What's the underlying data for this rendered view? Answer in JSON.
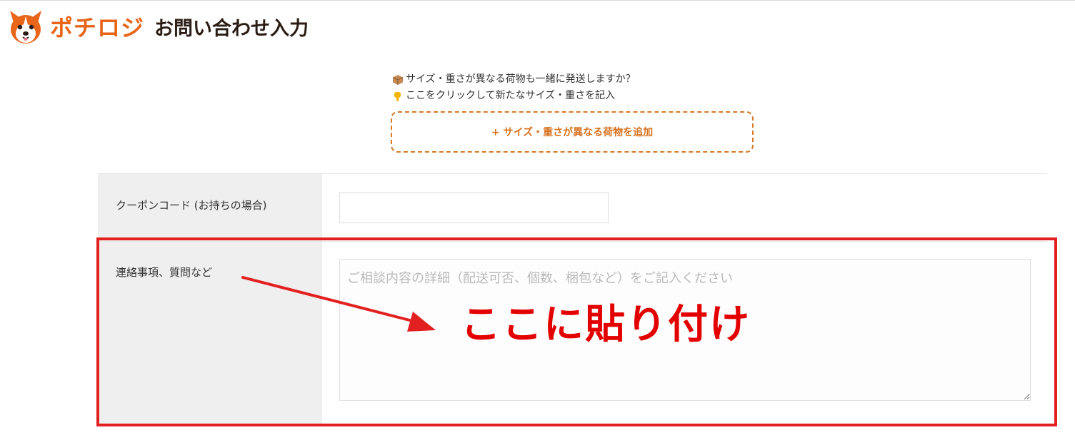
{
  "header": {
    "logo_text": "ポチロジ",
    "logo_icon": "dog-face-icon",
    "title": "お問い合わせ入力"
  },
  "info": {
    "line1_icon": "package-icon",
    "line1": "サイズ・重さが異なる荷物も一緒に発送しますか？",
    "line2_icon": "pointing-hand-icon",
    "line2": "ここをクリックして新たなサイズ・重さを記入"
  },
  "add_button": {
    "label": "+ サイズ・重さが異なる荷物を追加"
  },
  "form": {
    "coupon": {
      "label": "クーポンコード (お持ちの場合)",
      "value": "",
      "placeholder": ""
    },
    "notes": {
      "label": "連絡事項、質問など",
      "value": "",
      "placeholder": "ご相談内容の詳細（配送可否、個数、梱包など）をご記入ください"
    }
  },
  "annotation": {
    "text": "ここに貼り付け",
    "color": "#e30000",
    "box_color": "#e32020"
  },
  "colors": {
    "brand_orange": "#e8651a",
    "button_border": "#d67b25",
    "button_text": "#d6701e"
  }
}
